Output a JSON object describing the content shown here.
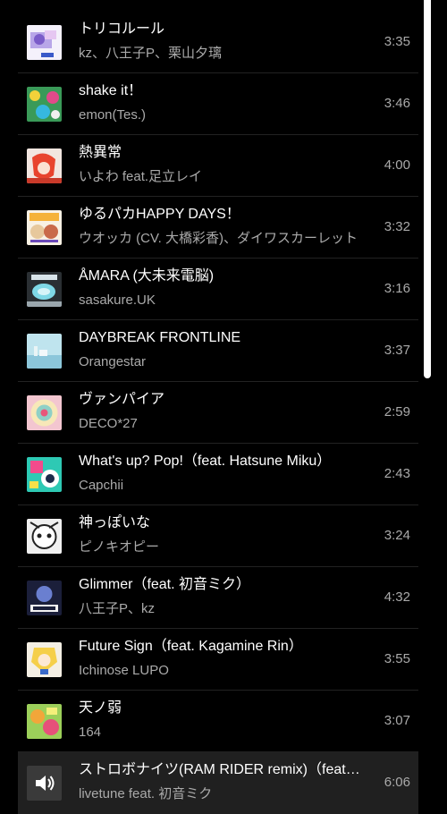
{
  "tracks": [
    {
      "title": "トリコルール",
      "artist": "kz、八王子P、栗山夕璃",
      "duration": "3:35",
      "thumb": "album-art-tricolore-icon",
      "playing": false
    },
    {
      "title": "shake it！",
      "artist": "emon(Tes.)",
      "duration": "3:46",
      "thumb": "album-art-shake-it-icon",
      "playing": false
    },
    {
      "title": "熱異常",
      "artist": "いよわ feat.足立レイ",
      "duration": "4:00",
      "thumb": "album-art-netsuijou-icon",
      "playing": false
    },
    {
      "title": "ゆるパカHAPPY DAYS！",
      "artist": "ウオッカ (CV. 大橋彩香)、ダイワスカーレット",
      "duration": "3:32",
      "thumb": "album-art-yurupaka-icon",
      "playing": false
    },
    {
      "title": "ÅMARA (大未来電脳)",
      "artist": "sasakure.UK",
      "duration": "3:16",
      "thumb": "album-art-amara-icon",
      "playing": false
    },
    {
      "title": "DAYBREAK FRONTLINE",
      "artist": "Orangestar",
      "duration": "3:37",
      "thumb": "album-art-daybreak-frontline-icon",
      "playing": false
    },
    {
      "title": "ヴァンパイア",
      "artist": "DECO*27",
      "duration": "2:59",
      "thumb": "album-art-vampire-icon",
      "playing": false
    },
    {
      "title": "What's up? Pop!（feat. Hatsune Miku）",
      "artist": "Capchii",
      "duration": "2:43",
      "thumb": "album-art-whats-up-pop-icon",
      "playing": false
    },
    {
      "title": "神っぽいな",
      "artist": "ピノキオピー",
      "duration": "3:24",
      "thumb": "album-art-kamippoina-icon",
      "playing": false
    },
    {
      "title": "Glimmer（feat. 初音ミク）",
      "artist": "八王子P、kz",
      "duration": "4:32",
      "thumb": "album-art-glimmer-hideout-icon",
      "playing": false
    },
    {
      "title": "Future Sign（feat. Kagamine Rin）",
      "artist": "Ichinose LUPO",
      "duration": "3:55",
      "thumb": "album-art-future-sign-icon",
      "playing": false
    },
    {
      "title": "天ノ弱",
      "artist": "164",
      "duration": "3:07",
      "thumb": "album-art-amanojaku-icon",
      "playing": false
    },
    {
      "title": "ストロボナイツ(RAM RIDER remix)（feat. 初音ミク）",
      "artist": "livetune feat. 初音ミク",
      "duration": "6:06",
      "thumb": "now-playing-speaker-icon",
      "playing": true
    }
  ],
  "colors": {
    "background": "#000000",
    "row_divider": "#222222",
    "playing_row": "#202020",
    "primary_text": "#ffffff",
    "secondary_text": "#aaaaaa"
  }
}
